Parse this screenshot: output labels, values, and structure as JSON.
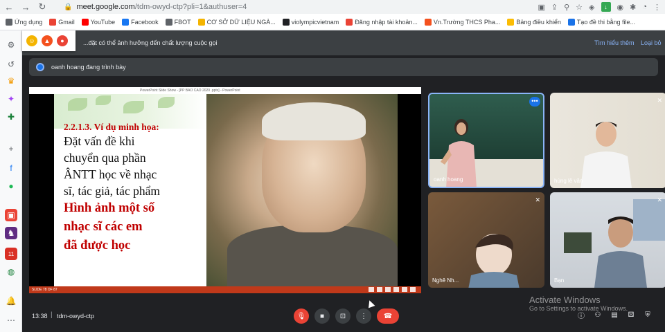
{
  "browser": {
    "url_host": "meet.google.com",
    "url_path": "/tdm-owyd-ctp?pli=1&authuser=4",
    "bookmarks": [
      {
        "label": "Ứng dụng",
        "color": "#5f6368"
      },
      {
        "label": "Gmail",
        "color": "#ea4335"
      },
      {
        "label": "YouTube",
        "color": "#ff0000"
      },
      {
        "label": "Facebook",
        "color": "#1877f2"
      },
      {
        "label": "FBOT",
        "color": "#5f6368"
      },
      {
        "label": "CƠ SỞ DỮ LIỆU NGÀ...",
        "color": "#f4b400"
      },
      {
        "label": "violympicvietnam",
        "color": "#202124"
      },
      {
        "label": "Đăng nhập tài khoản...",
        "color": "#ea4335"
      },
      {
        "label": "Vn.Trường THCS Pha...",
        "color": "#f4511e"
      },
      {
        "label": "Bảng điều khiển",
        "color": "#fbbc04"
      },
      {
        "label": "Tạo đề thi bằng file...",
        "color": "#1a73e8"
      }
    ]
  },
  "meet": {
    "banner_text": "...đặt có thể ảnh hưởng đến chất lượng cuộc gọi",
    "learn_more": "Tìm hiểu thêm",
    "dismiss": "Loại bỏ",
    "presenting_text": "oanh hoang đang trình bày",
    "slide": {
      "window_title": "PowerPoint Slide Show - [PP BAO CAO 2020 .pptx] - PowerPoint",
      "heading": "2.2.1.3. Ví dụ minh họa:",
      "body_lines": [
        "Đặt vấn đề khi",
        "chuyển qua phần",
        "ÂNTT học về nhạc",
        "sĩ, tác giả, tác phẩm"
      ],
      "red_lines": [
        "Hình ảnh một số",
        "nhạc sĩ các em",
        "đã được học"
      ],
      "footer": "SLIDE 78 OF 87"
    },
    "participants": [
      {
        "name": "oanh hoang",
        "accent": "#8ab4f8"
      },
      {
        "name": "hùng lê văn"
      },
      {
        "name": "Nghê Nh..."
      },
      {
        "name": "Bạn"
      }
    ],
    "time": "13:38",
    "meeting_code": "tdm-owyd-ctp",
    "watermark_title": "Activate Windows",
    "watermark_sub": "Go to Settings to activate Windows."
  }
}
